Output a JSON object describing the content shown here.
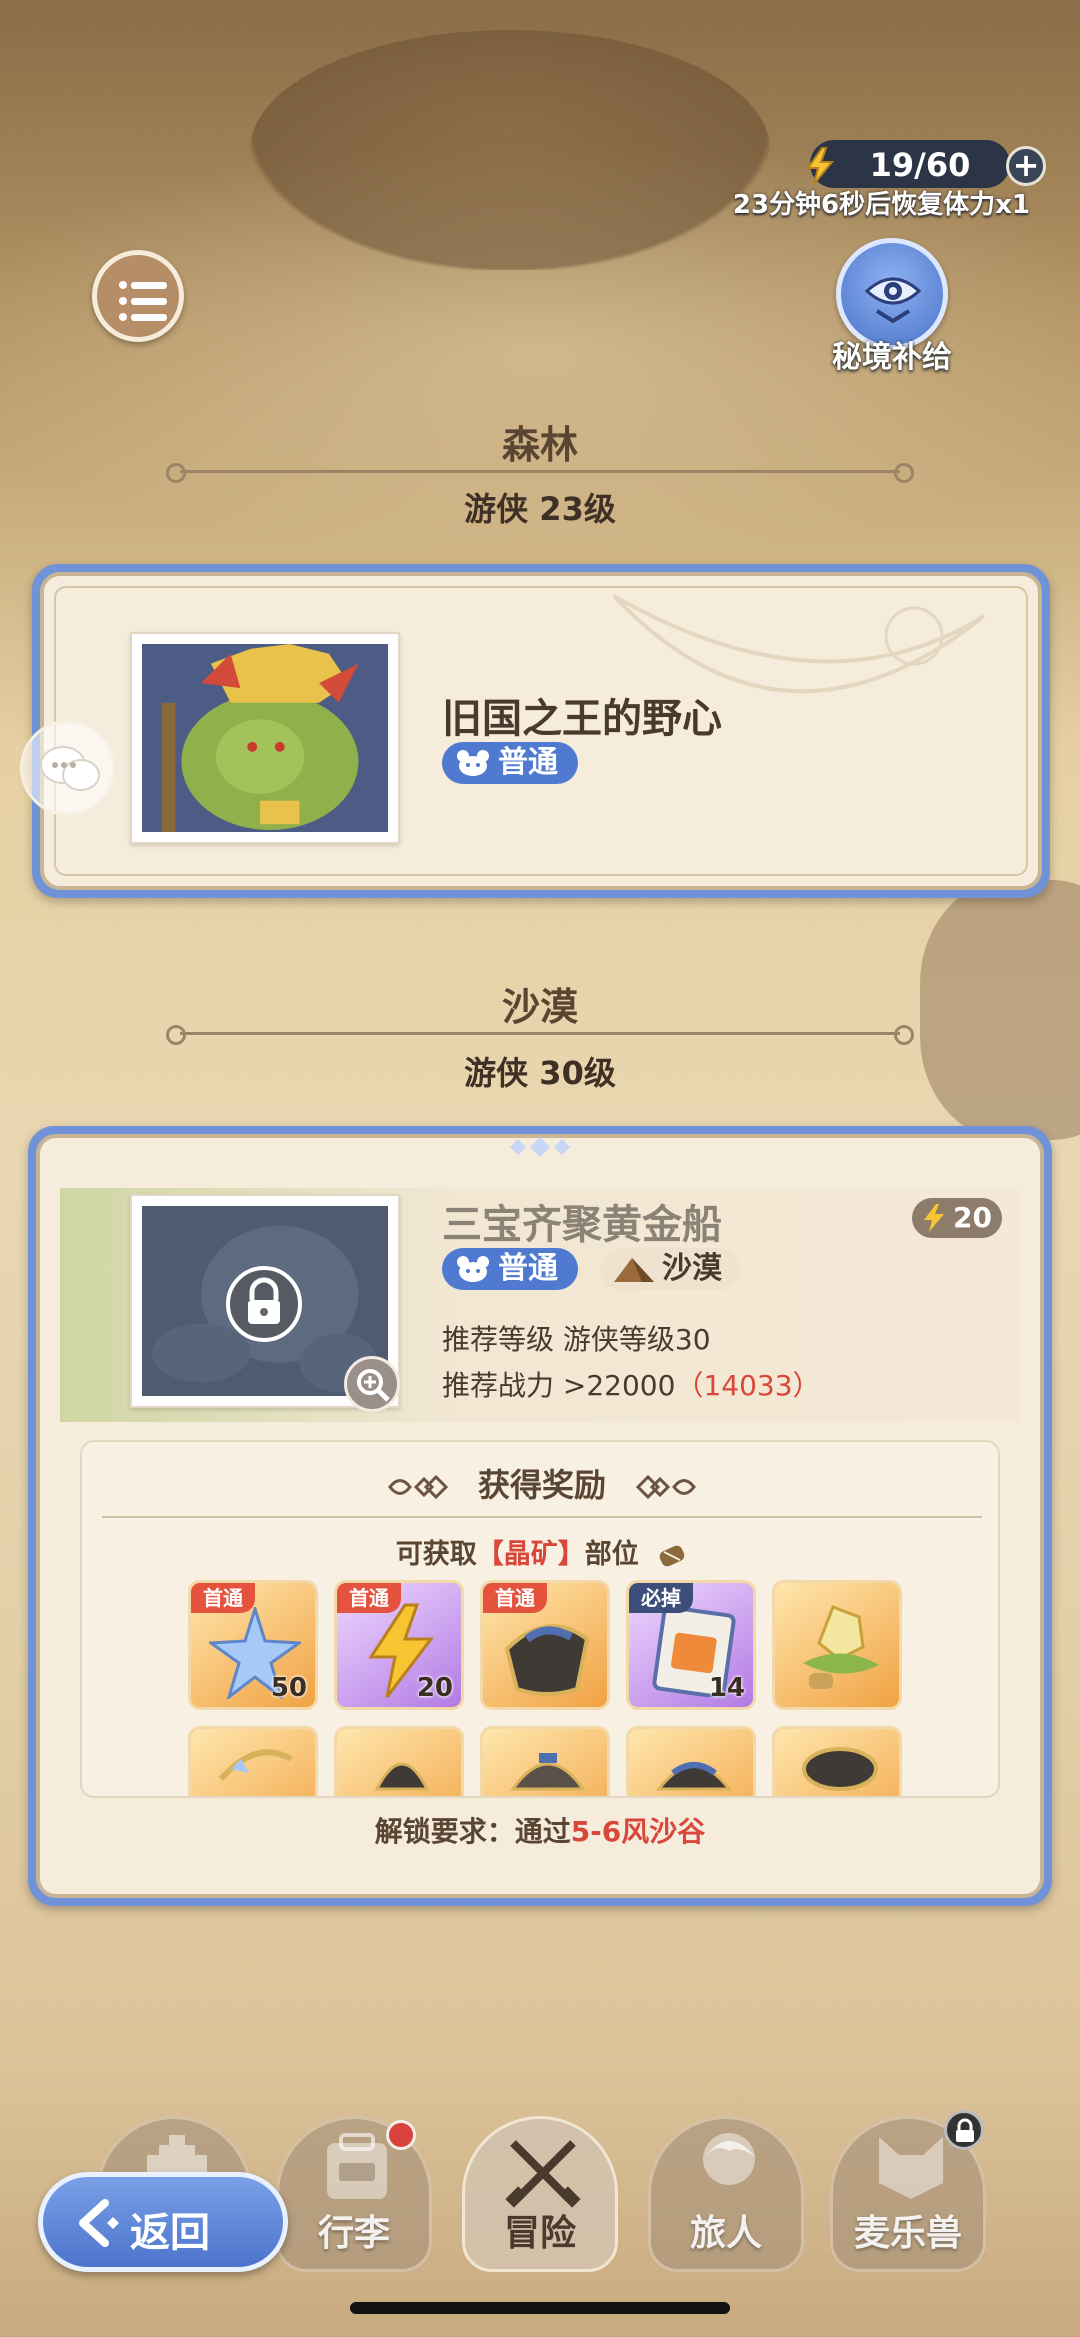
{
  "header": {
    "stamina": "19/60",
    "recover_text": "23分钟6秒后恢复体力x1",
    "plus_label": "+",
    "supply_label": "秘境补给"
  },
  "sections": [
    {
      "title": "森林",
      "sub": "游侠  23级",
      "stage_name": "旧国之王的野心",
      "difficulty": "普通"
    },
    {
      "title": "沙漠",
      "sub": "游侠  30级",
      "stage_name": "三宝齐聚黄金船",
      "difficulty": "普通",
      "region": "沙漠",
      "cost": "20",
      "rec_level_label": "推荐等级 游侠等级30",
      "rec_power_label": "推荐战力 >22000",
      "rec_power_current": "（14033）",
      "rewards_title": "获得奖励",
      "rewards_sub_prefix": "可获取",
      "rewards_sub_highlight": "【晶矿】",
      "rewards_sub_suffix": "部位",
      "unlock_prefix": "解锁要求：通过",
      "unlock_stage": "5-6风沙谷"
    }
  ],
  "rewards": [
    {
      "tag": "首通",
      "qty": "50",
      "icon": "star-crystal-icon"
    },
    {
      "tag": "首通",
      "qty": "20",
      "icon": "lightning-icon"
    },
    {
      "tag": "首通",
      "qty": "",
      "icon": "armor-piece-icon"
    },
    {
      "tag": "必掉",
      "qty": "14",
      "icon": "ticket-card-icon"
    },
    {
      "tag": "",
      "qty": "",
      "icon": "crystal-leaf-icon"
    }
  ],
  "nav": {
    "back_label": "返回",
    "items": [
      "行李",
      "冒险",
      "旅人",
      "麦乐兽"
    ]
  },
  "colors": {
    "card_border": "#6f93d6",
    "badge_blue": "#4f7ad0",
    "accent_red": "#d9473a"
  }
}
